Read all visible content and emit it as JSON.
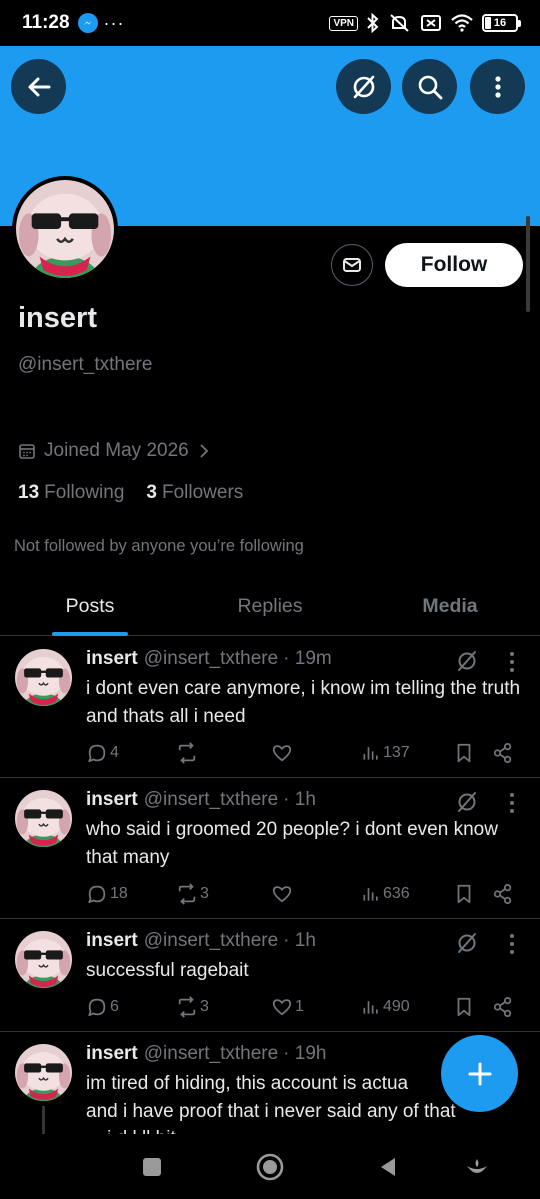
{
  "status_bar": {
    "time": "11:28",
    "dots": "···",
    "vpn": "VPN",
    "battery": "16"
  },
  "colors": {
    "banner": "#1d9bf0",
    "accent": "#1d9bf0",
    "background": "#000000",
    "muted": "#71767b",
    "text": "#e7e9ea"
  },
  "header": {
    "back_icon": "arrow-left-icon",
    "grok_icon": "grok-icon",
    "search_icon": "search-icon",
    "more_icon": "more-vertical-icon"
  },
  "profile": {
    "display_name": "insert",
    "handle": "@insert_txthere",
    "joined": "Joined May 2026",
    "following_count": "13",
    "following_label": "Following",
    "followers_count": "3",
    "followers_label": "Followers",
    "not_followed": "Not followed by anyone you’re following",
    "follow_label": "Follow"
  },
  "tabs": [
    {
      "label": "Posts",
      "active": true
    },
    {
      "label": "Replies",
      "active": false
    },
    {
      "label": "Media",
      "active": false
    }
  ],
  "posts": [
    {
      "name": "insert",
      "handle": "@insert_txthere",
      "time": "· 19m",
      "text": "i dont even care anymore, i know im telling the truth and thats all i need",
      "replies": "4",
      "reposts": "",
      "likes": "",
      "views": "137"
    },
    {
      "name": "insert",
      "handle": "@insert_txthere",
      "time": "· 1h",
      "text": "who said i groomed 20 people? i dont even know that many",
      "replies": "18",
      "reposts": "3",
      "likes": "",
      "views": "636"
    },
    {
      "name": "insert",
      "handle": "@insert_txthere",
      "time": "· 1h",
      "text": "successful ragebait",
      "replies": "6",
      "reposts": "3",
      "likes": "1",
      "views": "490"
    },
    {
      "name": "insert",
      "handle": "@insert_txthere",
      "time": "· 19h",
      "text": "im tired of hiding, this account is actua and i have proof that i never said any of that",
      "line1": "im tired of hiding, this account is actua",
      "line2": "and i have proof that i never said any of that",
      "line3": "... i d l ll bit"
    }
  ],
  "fab": {
    "icon": "plus-icon"
  },
  "navbar": {
    "icons": [
      "recents-icon",
      "home-icon",
      "back-icon",
      "assistant-icon"
    ]
  }
}
